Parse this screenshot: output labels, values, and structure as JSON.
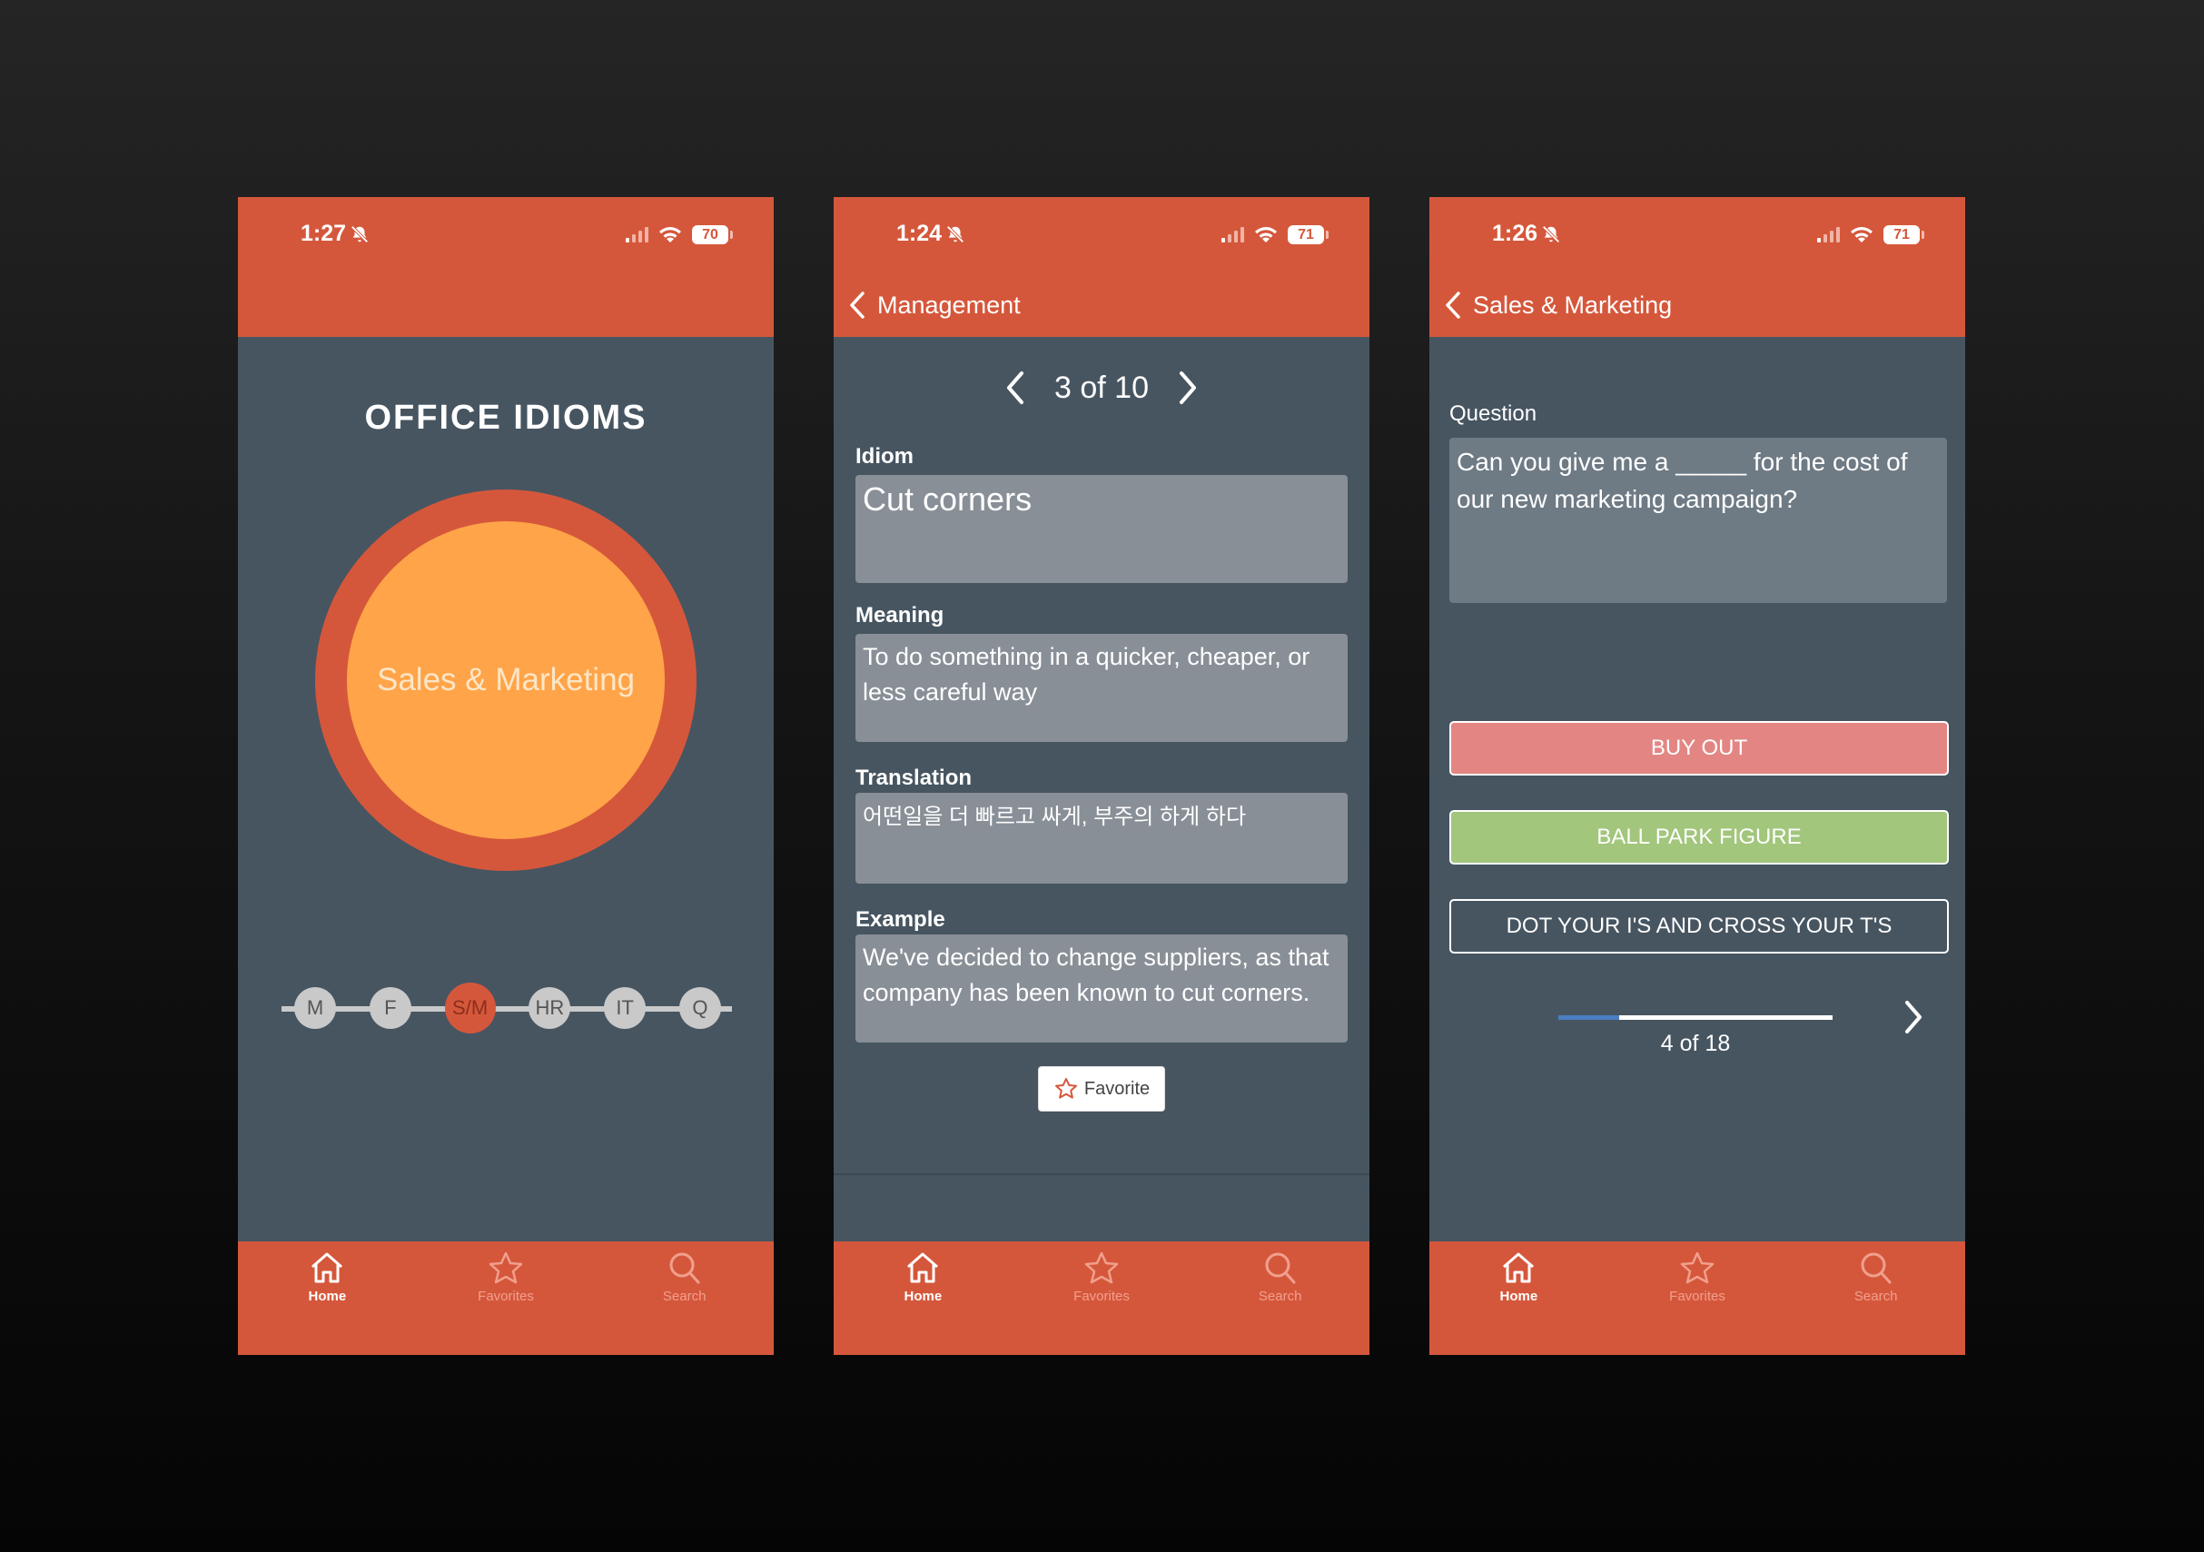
{
  "screens": {
    "home": {
      "status": {
        "time": "1:27",
        "battery": "70"
      },
      "title": "OFFICE IDIOMS",
      "selected_category": "Sales & Marketing",
      "categories": [
        "M",
        "F",
        "S/M",
        "HR",
        "IT",
        "Q"
      ],
      "active_category_index": 2,
      "tabs": [
        "Home",
        "Favorites",
        "Search"
      ]
    },
    "detail": {
      "status": {
        "time": "1:24",
        "battery": "71"
      },
      "back_label": "Management",
      "pager": "3 of 10",
      "labels": {
        "idiom": "Idiom",
        "meaning": "Meaning",
        "translation": "Translation",
        "example": "Example"
      },
      "idiom": "Cut corners",
      "meaning": "To do something in a quicker, cheaper, or less careful way",
      "translation": "어떤일을 더 빠르고 싸게, 부주의 하게 하다",
      "example": "We've decided to change suppliers, as that company has been known to cut corners.",
      "favorite_label": "Favorite",
      "tabs": [
        "Home",
        "Favorites",
        "Search"
      ]
    },
    "quiz": {
      "status": {
        "time": "1:26",
        "battery": "71"
      },
      "back_label": "Sales & Marketing",
      "question_label": "Question",
      "question": "Can you give me a _____ for the cost of our new marketing campaign?",
      "answers": [
        {
          "text": "BUY OUT",
          "state": "wrong"
        },
        {
          "text": "BALL PARK FIGURE",
          "state": "correct"
        },
        {
          "text": "DOT YOUR I'S AND CROSS YOUR T'S",
          "state": "neutral"
        }
      ],
      "progress": {
        "current": 4,
        "total": 18,
        "label": "4 of 18"
      },
      "tabs": [
        "Home",
        "Favorites",
        "Search"
      ]
    }
  },
  "colors": {
    "accent": "#D5573B",
    "background": "#475561",
    "circle": "#FFA448",
    "wrong": "#E38683",
    "correct": "#A2C67C",
    "progress": "#4a7fc1"
  },
  "icons": [
    "muted-bell-icon",
    "signal-icon",
    "wifi-icon",
    "battery-icon",
    "chevron-left-icon",
    "chevron-right-icon",
    "home-icon",
    "star-icon",
    "search-icon"
  ]
}
